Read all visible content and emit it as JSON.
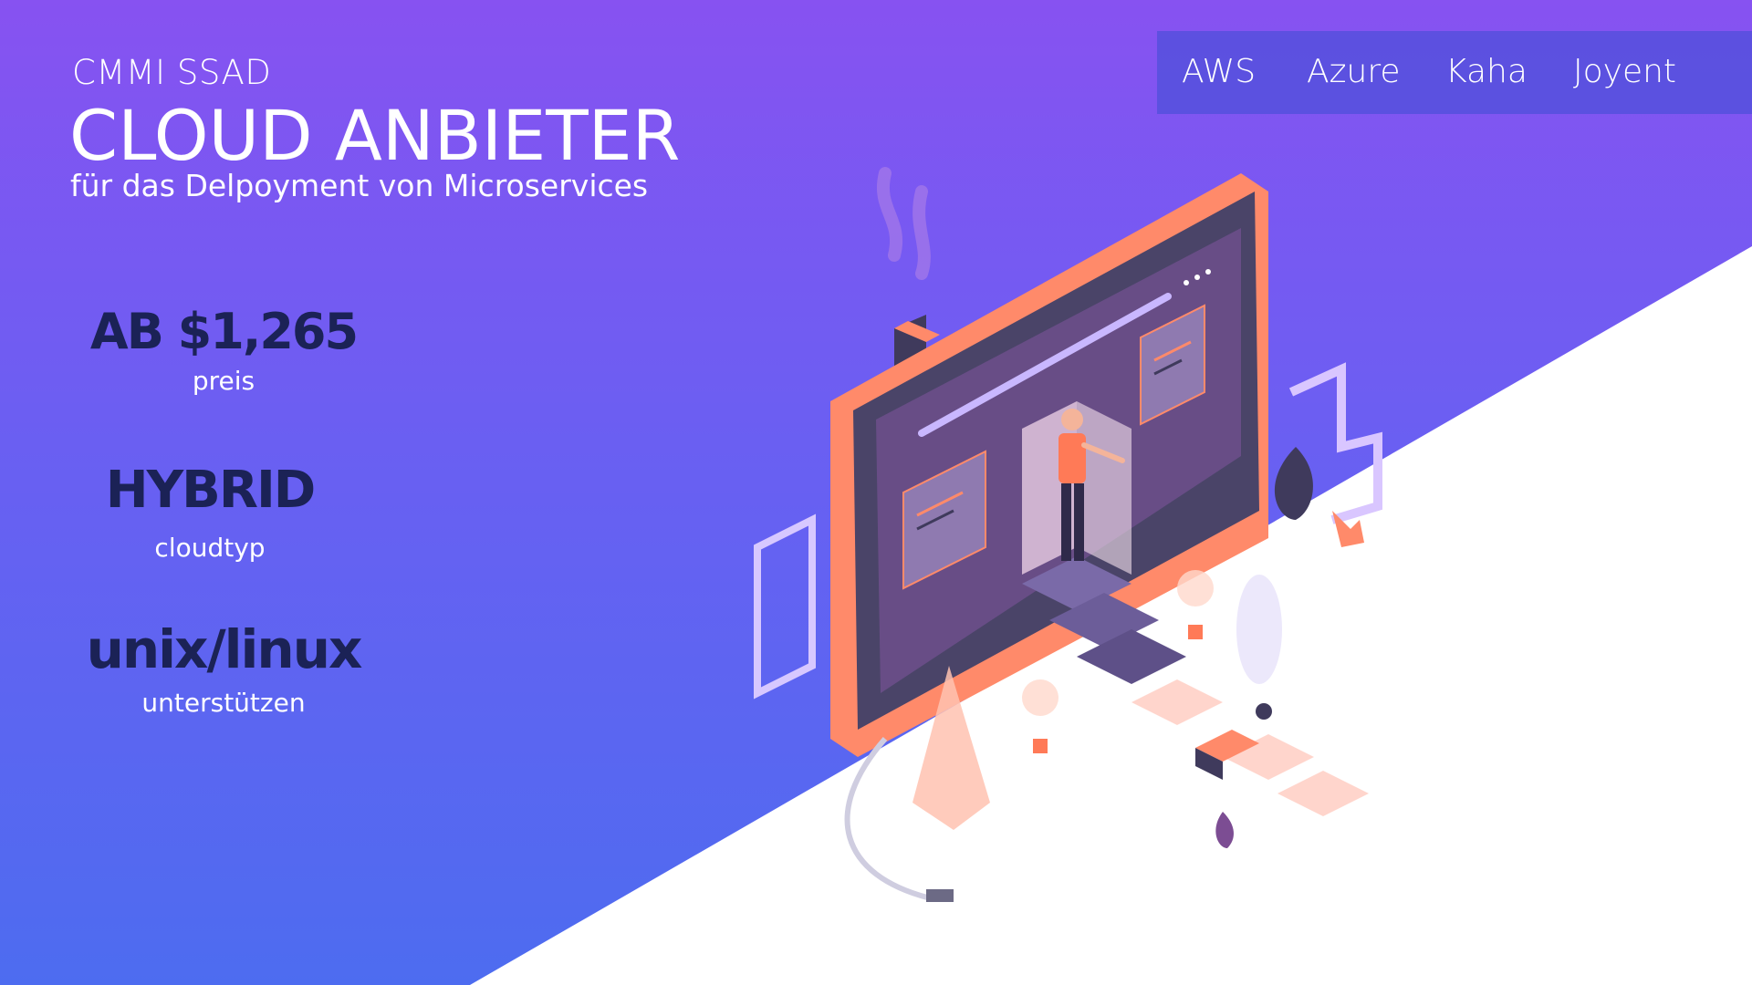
{
  "header": {
    "eyebrow": "CMMI SSAD",
    "title": "CLOUD ANBIETER",
    "subtitle": "für das Delpoyment von Microservices"
  },
  "nav": {
    "items": [
      {
        "label": "AWS"
      },
      {
        "label": "Azure"
      },
      {
        "label": "Kaha"
      },
      {
        "label": "Joyent"
      }
    ]
  },
  "stats": [
    {
      "value": "AB $1,265",
      "label": "preis"
    },
    {
      "value": "HYBRID",
      "label": "cloudtyp"
    },
    {
      "value": "unix/linux",
      "label": "unterstützen"
    }
  ],
  "illustration": {
    "icon": "isometric-developer-monitor-illustration"
  },
  "colors": {
    "bg_top": "#8752f1",
    "bg_bottom": "#4d6cf0",
    "stat_text": "#1b2256",
    "accent_orange": "#ff8a6a",
    "monitor_dark": "#4a4468"
  }
}
